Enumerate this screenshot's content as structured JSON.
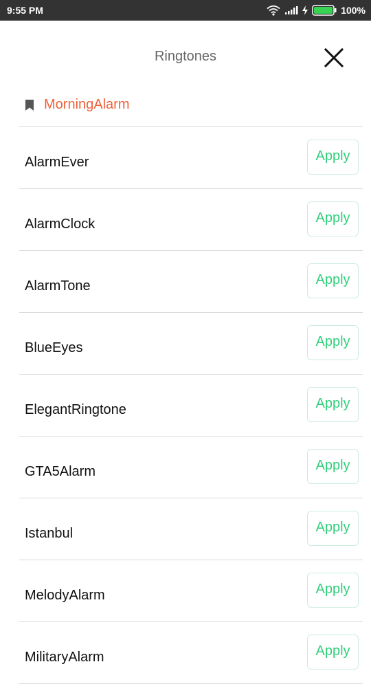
{
  "status_bar": {
    "time": "9:55 PM",
    "battery": "100%",
    "icons": [
      "wifi-icon",
      "signal-icon",
      "charging-icon",
      "battery-icon"
    ]
  },
  "header": {
    "title": "Ringtones",
    "close_icon": "close-icon"
  },
  "current": {
    "icon": "bookmark-icon",
    "label": "MorningAlarm"
  },
  "ringtones": [
    {
      "name": "AlarmEver",
      "action": "Apply"
    },
    {
      "name": "AlarmClock",
      "action": "Apply"
    },
    {
      "name": "AlarmTone",
      "action": "Apply"
    },
    {
      "name": "BlueEyes",
      "action": "Apply"
    },
    {
      "name": "ElegantRingtone",
      "action": "Apply"
    },
    {
      "name": "GTA5Alarm",
      "action": "Apply"
    },
    {
      "name": "Istanbul",
      "action": "Apply"
    },
    {
      "name": "MelodyAlarm",
      "action": "Apply"
    },
    {
      "name": "MilitaryAlarm",
      "action": "Apply"
    }
  ],
  "colors": {
    "status_bar_bg": "#333333",
    "current_label": "#f0613a",
    "apply_text": "#2fcf7a",
    "battery": "#39d353"
  }
}
